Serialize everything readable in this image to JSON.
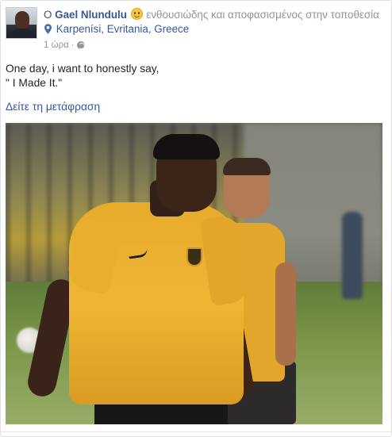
{
  "post": {
    "prefix": "O",
    "author": "Gael Nlundulu",
    "feeling": "ενθουσιώδης και αποφασισμένος στην τοποθεσία",
    "location": "Karpenísi, Evritania, Greece",
    "time": "1 ώρα",
    "separator": "·",
    "privacy_icon": "globe-icon",
    "text_line1": "One day, i want to honestly say,",
    "text_line2": "\" I Made It.\"",
    "translate_label": "Δείτε τη μετάφραση"
  },
  "colors": {
    "link": "#365899",
    "meta": "#90949c",
    "text": "#1d2129",
    "jersey": "#f0b534"
  }
}
